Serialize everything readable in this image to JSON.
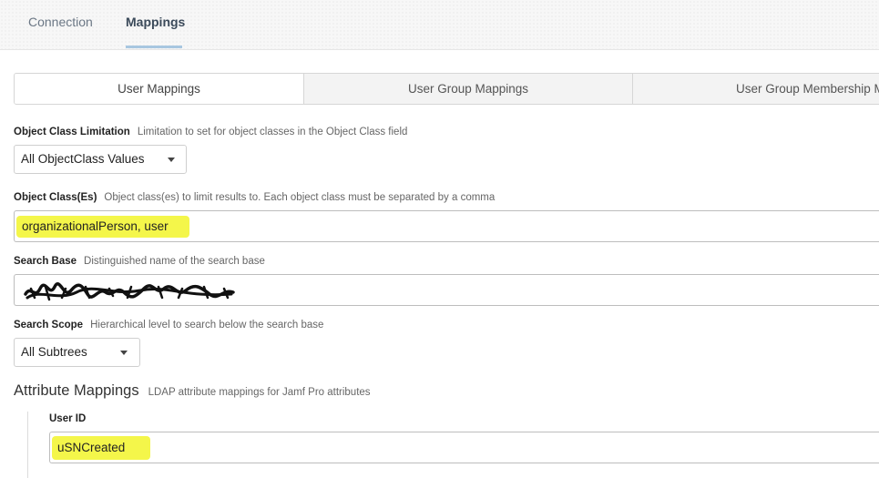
{
  "tabs": [
    {
      "label": "Connection",
      "active": false
    },
    {
      "label": "Mappings",
      "active": true
    }
  ],
  "subtabs": [
    {
      "label": "User Mappings",
      "active": true
    },
    {
      "label": "User Group Mappings",
      "active": false
    },
    {
      "label": "User Group Membership M",
      "active": false
    }
  ],
  "object_class_limitation": {
    "label": "Object Class Limitation",
    "hint": "Limitation to set for object classes in the Object Class field",
    "value": "All ObjectClass Values"
  },
  "object_classes": {
    "label": "Object Class(Es)",
    "hint": "Object class(es) to limit results to. Each object class must be separated by a comma",
    "value": "organizationalPerson, user"
  },
  "search_base": {
    "label": "Search Base",
    "hint": "Distinguished name of the search base",
    "value_redacted": true
  },
  "search_scope": {
    "label": "Search Scope",
    "hint": "Hierarchical level to search below the search base",
    "value": "All Subtrees"
  },
  "attribute_mappings": {
    "title": "Attribute Mappings",
    "hint": "LDAP attribute mappings for Jamf Pro attributes",
    "user_id": {
      "label": "User ID",
      "value": "uSNCreated"
    }
  },
  "colors": {
    "highlight": "#f4f64a",
    "tab_underline": "#a8c7e0"
  }
}
